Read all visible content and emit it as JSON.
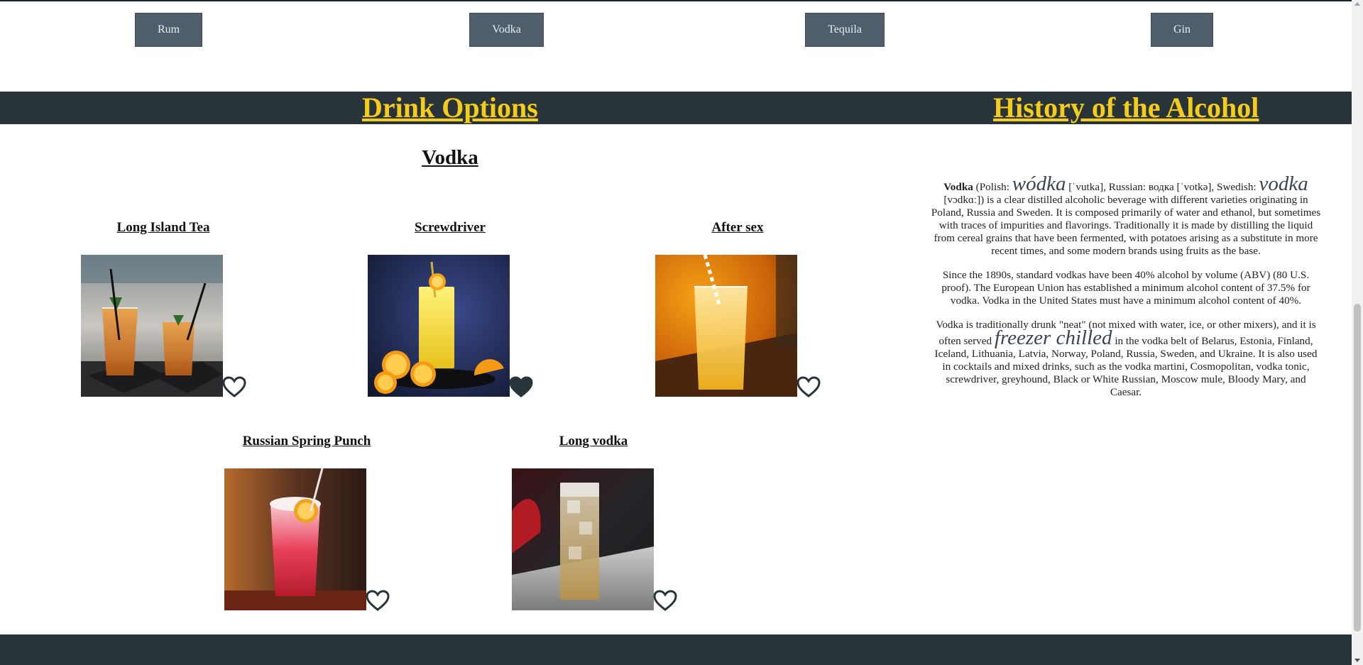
{
  "categories": [
    "Rum",
    "Vodka",
    "Tequila",
    "Gin"
  ],
  "header": {
    "drink_options": "Drink Options",
    "history_title": "History of the Alcohol"
  },
  "section_title": "Vodka",
  "drinks": [
    {
      "name": "Long Island Tea",
      "favorited": false
    },
    {
      "name": "Screwdriver",
      "favorited": true
    },
    {
      "name": "After sex",
      "favorited": false
    },
    {
      "name": "Russian Spring Punch",
      "favorited": false
    },
    {
      "name": "Long vodka",
      "favorited": false
    }
  ],
  "history": {
    "p1_bold": "Vodka",
    "p1_a": " (Polish: ",
    "p1_polish": "wódka",
    "p1_b": " [ˈvutka], Russian: водка [ˈvotkə], Swedish: ",
    "p1_swedish": "vodka",
    "p1_c": " [vɔdkɑː]) is a clear distilled alcoholic beverage with different varieties originating in Poland, Russia and Sweden. It is composed primarily of water and ethanol, but sometimes with traces of impurities and flavorings. Traditionally it is made by distilling the liquid from cereal grains that have been fermented, with potatoes arising as a substitute in more recent times, and some modern brands using fruits as the base.",
    "p2": "Since the 1890s, standard vodkas have been 40% alcohol by volume (ABV) (80 U.S. proof). The European Union has established a minimum alcohol content of 37.5% for vodka. Vodka in the United States must have a minimum alcohol content of 40%.",
    "p3_a": "Vodka is traditionally drunk \"neat\" (not mixed with water, ice, or other mixers), and it is often served ",
    "p3_big": "freezer chilled",
    "p3_b": " in the vodka belt of Belarus, Estonia, Finland, Iceland, Lithuania, Latvia, Norway, Poland, Russia, Sweden, and Ukraine. It is also used in cocktails and mixed drinks, such as the vodka martini, Cosmopolitan, vodka tonic, screwdriver, greyhound, Black or White Russian, Moscow mule, Bloody Mary, and Caesar."
  },
  "colors": {
    "band": "#29333a",
    "button": "#4e5f6b",
    "title_yellow": "#f5cc1c"
  }
}
